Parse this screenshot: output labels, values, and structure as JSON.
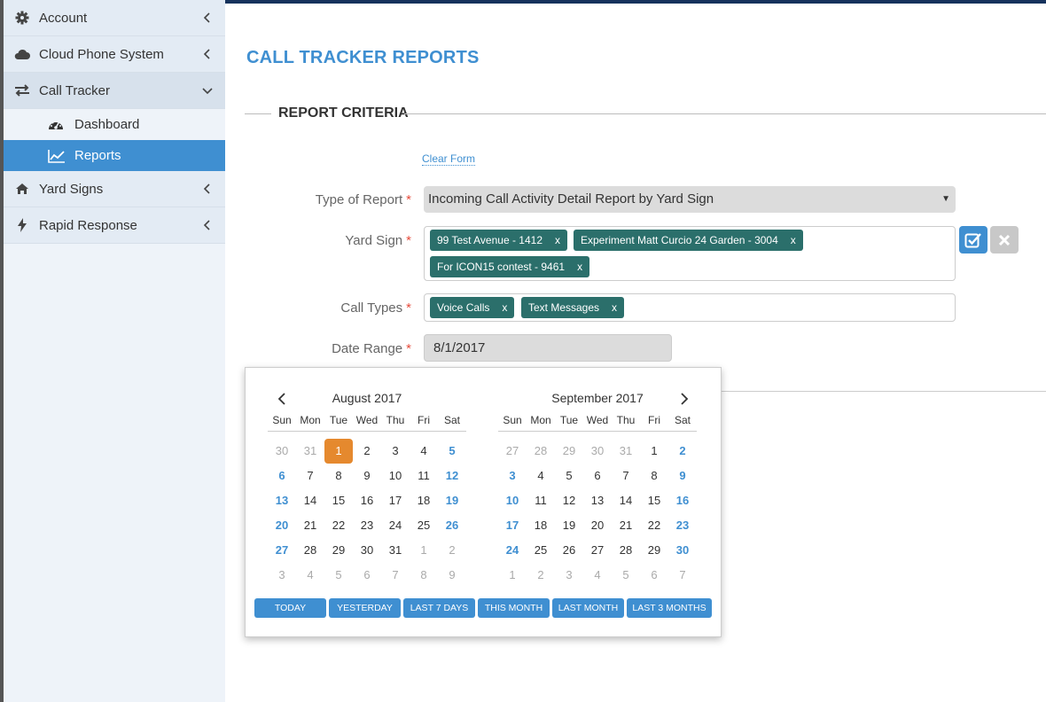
{
  "sidebar": {
    "items": [
      {
        "label": "Account",
        "icon": "gear-icon"
      },
      {
        "label": "Cloud Phone System",
        "icon": "cloud-icon"
      },
      {
        "label": "Call Tracker",
        "icon": "exchange-icon"
      },
      {
        "label": "Yard Signs",
        "icon": "home-icon"
      },
      {
        "label": "Rapid Response",
        "icon": "bolt-icon"
      }
    ],
    "subitems": [
      {
        "label": "Dashboard",
        "icon": "dashboard-icon"
      },
      {
        "label": "Reports",
        "icon": "line-chart-icon"
      }
    ],
    "active_subitem": "Reports"
  },
  "page": {
    "title": "CALL TRACKER REPORTS",
    "section": "REPORT CRITERIA",
    "clear_form": "Clear Form"
  },
  "form": {
    "type_of_report": {
      "label": "Type of Report",
      "value": "Incoming Call Activity Detail Report by Yard Sign"
    },
    "yard_sign": {
      "label": "Yard Sign",
      "tags": [
        "99 Test Avenue - 1412",
        "Experiment Matt Curcio 24 Garden - 3004",
        "For ICON15 contest - 9461"
      ]
    },
    "call_types": {
      "label": "Call Types",
      "tags": [
        "Voice Calls",
        "Text Messages"
      ]
    },
    "date_range": {
      "label": "Date Range",
      "value": "8/1/2017"
    },
    "required_marker": "*",
    "tag_remove": "x"
  },
  "datepicker": {
    "dows": [
      "Sun",
      "Mon",
      "Tue",
      "Wed",
      "Thu",
      "Fri",
      "Sat"
    ],
    "months": [
      {
        "title": "August 2017",
        "days": [
          "30",
          "31",
          "1",
          "2",
          "3",
          "4",
          "5",
          "6",
          "7",
          "8",
          "9",
          "10",
          "11",
          "12",
          "13",
          "14",
          "15",
          "16",
          "17",
          "18",
          "19",
          "20",
          "21",
          "22",
          "23",
          "24",
          "25",
          "26",
          "27",
          "28",
          "29",
          "30",
          "31",
          "1",
          "2",
          "3",
          "4",
          "5",
          "6",
          "7",
          "8",
          "9"
        ],
        "lead_off": 2,
        "trail_off": 9,
        "selected": "1"
      },
      {
        "title": "September 2017",
        "days": [
          "27",
          "28",
          "29",
          "30",
          "31",
          "1",
          "2",
          "3",
          "4",
          "5",
          "6",
          "7",
          "8",
          "9",
          "10",
          "11",
          "12",
          "13",
          "14",
          "15",
          "16",
          "17",
          "18",
          "19",
          "20",
          "21",
          "22",
          "23",
          "24",
          "25",
          "26",
          "27",
          "28",
          "29",
          "30",
          "1",
          "2",
          "3",
          "4",
          "5",
          "6",
          "7"
        ],
        "lead_off": 5,
        "trail_off": 7,
        "selected": null
      }
    ],
    "ranges": [
      "TODAY",
      "YESTERDAY",
      "LAST 7 DAYS",
      "THIS MONTH",
      "LAST MONTH",
      "LAST 3 MONTHS"
    ]
  },
  "colors": {
    "accent": "#3f8fd1",
    "tag": "#2b6f6b",
    "selected_day": "#e5892e",
    "required": "#e74c3c"
  }
}
